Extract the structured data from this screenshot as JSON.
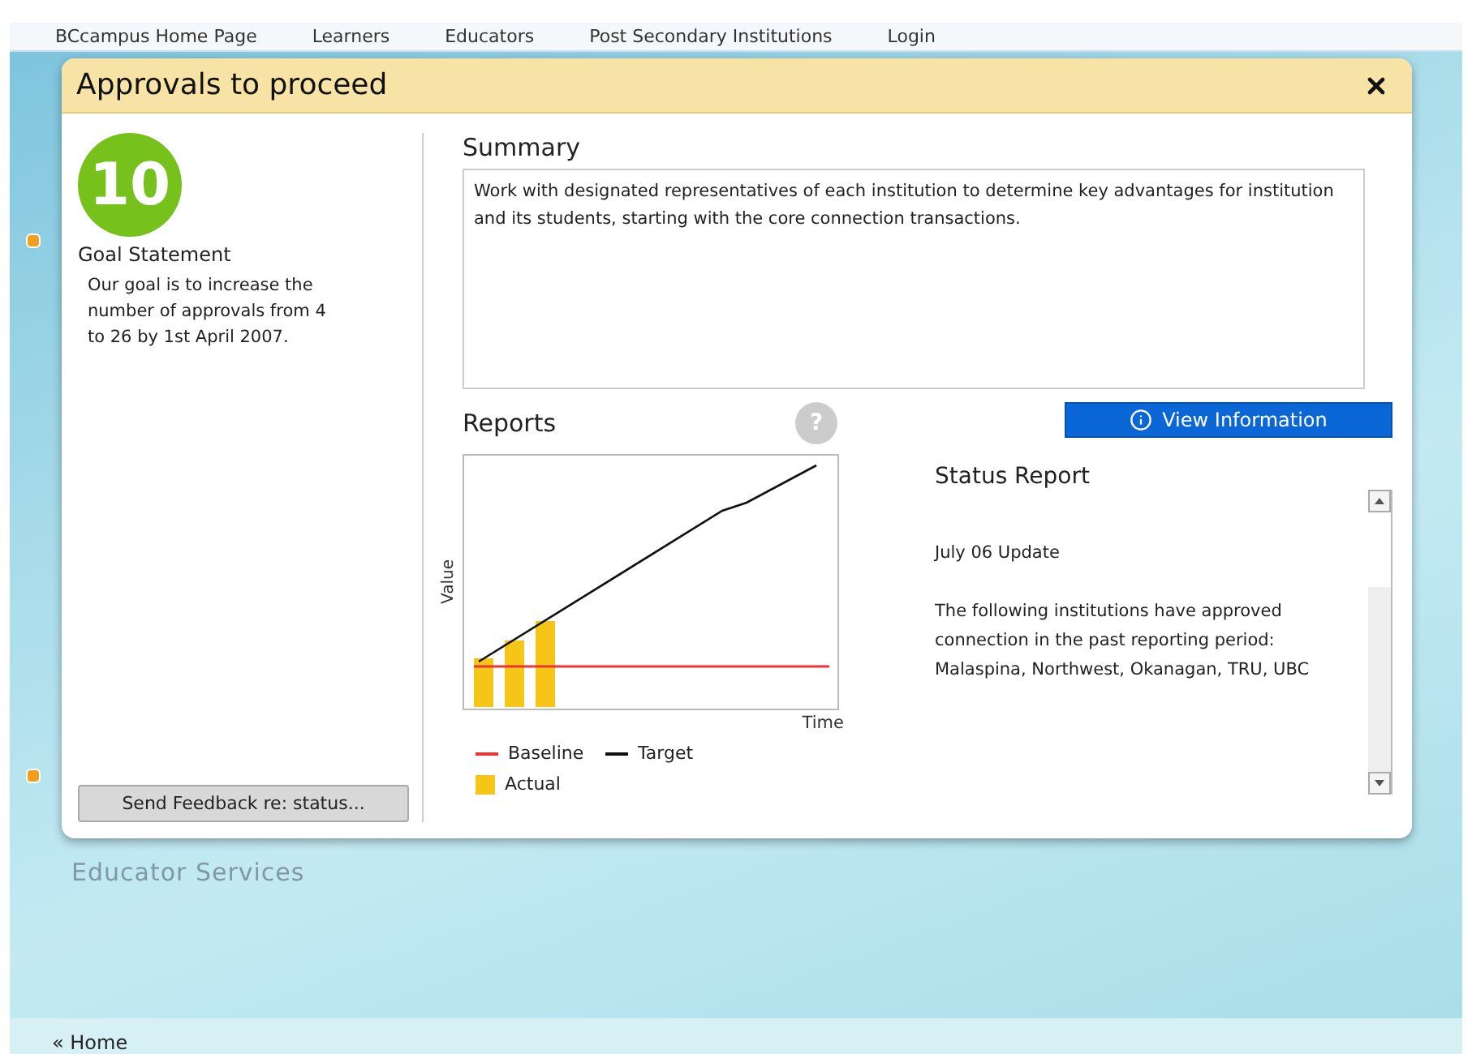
{
  "nav": {
    "links": [
      "BCcampus Home Page",
      "Learners",
      "Educators",
      "Post Secondary Institutions",
      "Login"
    ]
  },
  "dialog": {
    "title": "Approvals to proceed",
    "goal": {
      "number": "10",
      "heading": "Goal Statement",
      "text": "Our goal is to increase the number of approvals from 4 to 26 by 1st April 2007."
    },
    "feedback_button": "Send Feedback re: status...",
    "summary": {
      "heading": "Summary",
      "text": "Work with designated representatives of each institution to determine key advantages for institution and its students, starting with the core connection transactions."
    },
    "reports": {
      "heading": "Reports",
      "help": "?",
      "y_axis_label": "Value",
      "x_axis_label": "Time",
      "legend": [
        {
          "label": "Baseline",
          "kind": "line",
          "color": "#ee3333"
        },
        {
          "label": "Target",
          "kind": "line",
          "color": "#111111"
        },
        {
          "label": "Actual",
          "kind": "box",
          "color": "#f5c518"
        }
      ]
    },
    "view_button": "View Information",
    "status_report": {
      "heading": "Status Report",
      "lines": [
        "July 06 Update",
        "The following institutions have approved connection in the past reporting period: Malaspina, Northwest, Okanagan, TRU, UBC"
      ]
    }
  },
  "section_title": "Educator Services",
  "footer": {
    "link": "« Home"
  }
}
